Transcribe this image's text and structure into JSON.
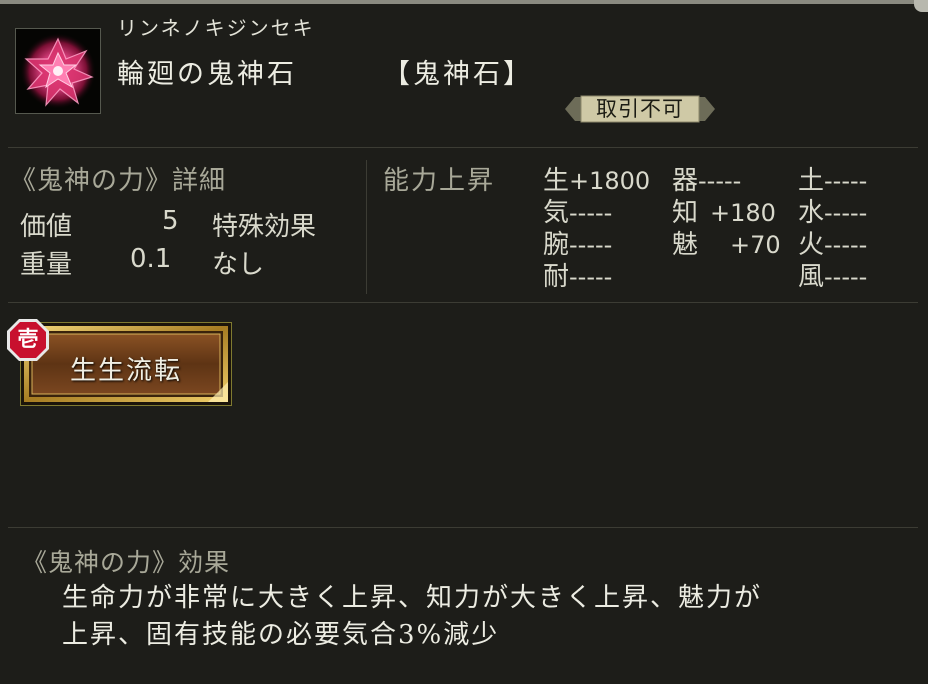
{
  "item": {
    "reading": "リンネノキジンセキ",
    "name": "輪廻の鬼神石",
    "category": "【鬼神石】",
    "icon": "crimson-crystal-icon",
    "trade_status": "取引不可"
  },
  "details": {
    "title": "《鬼神の力》詳細",
    "value_label": "価値",
    "value": "5",
    "weight_label": "重量",
    "weight": "0.1",
    "special_effect_label": "特殊効果",
    "special_effect": "なし"
  },
  "abilities": {
    "title": "能力上昇",
    "stats": [
      {
        "name": "生",
        "value": "+1800"
      },
      {
        "name": "器",
        "value": "-----"
      },
      {
        "name": "土",
        "value": "-----"
      },
      {
        "name": "気",
        "value": "-----"
      },
      {
        "name": "知",
        "value": "+180"
      },
      {
        "name": "水",
        "value": "-----"
      },
      {
        "name": "腕",
        "value": "-----"
      },
      {
        "name": "魅",
        "value": "+70"
      },
      {
        "name": "火",
        "value": "-----"
      },
      {
        "name": "耐",
        "value": "-----"
      },
      {
        "name": "風",
        "value": "-----"
      }
    ]
  },
  "skill": {
    "rank": "壱",
    "name": "生生流転"
  },
  "effect": {
    "title": "《鬼神の力》効果",
    "line1": "生命力が非常に大きく上昇、知力が大きく上昇、魅力が",
    "line2": "上昇、固有技能の必要気合3%減少"
  },
  "colors": {
    "background": "#1d1d19",
    "text": "#ecece2",
    "muted_text": "#a8a898",
    "skill_frame": "#c9a640",
    "skill_fill": "#6a3c16",
    "rank_badge": "#c8102e"
  }
}
